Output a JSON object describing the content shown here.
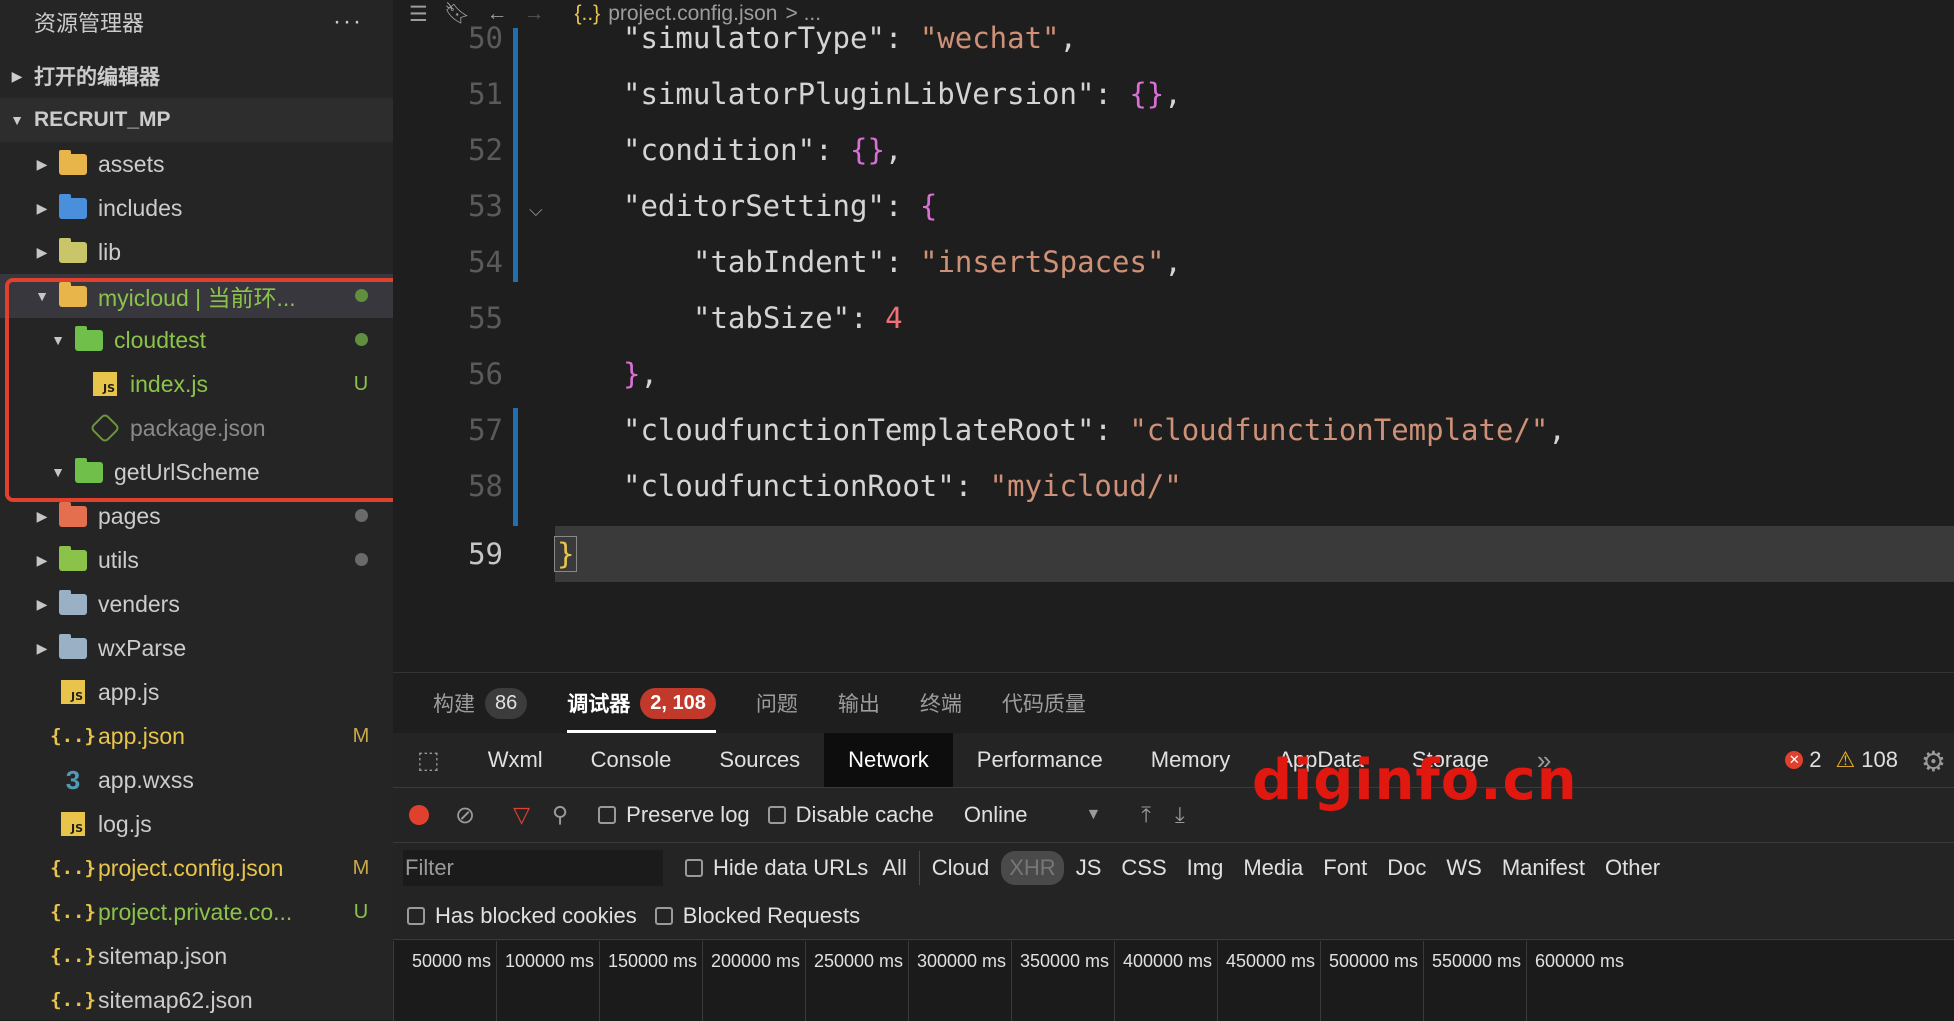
{
  "sidebar": {
    "title": "资源管理器",
    "more": "···",
    "open_editors": "打开的编辑器",
    "project": "RECRUIT_MP",
    "items": [
      {
        "label": "assets",
        "status": "",
        "icon": "folder-assets-icon"
      },
      {
        "label": "includes",
        "status": "",
        "icon": "folder-includes-icon"
      },
      {
        "label": "lib",
        "status": "",
        "icon": "folder-lib-icon"
      },
      {
        "label": "myicloud | 当前环...",
        "status": "",
        "icon": "folder-cloud-icon"
      },
      {
        "label": "cloudtest",
        "status": "",
        "icon": "folder-cloud-icon"
      },
      {
        "label": "index.js",
        "status": "U",
        "icon": "js-file-icon"
      },
      {
        "label": "package.json",
        "status": "",
        "icon": "package-json-icon"
      },
      {
        "label": "getUrlScheme",
        "status": "",
        "icon": "folder-cloud-icon"
      },
      {
        "label": "pages",
        "status": "",
        "icon": "folder-pages-icon"
      },
      {
        "label": "utils",
        "status": "",
        "icon": "folder-utils-icon"
      },
      {
        "label": "venders",
        "status": "",
        "icon": "folder-icon"
      },
      {
        "label": "wxParse",
        "status": "",
        "icon": "folder-icon"
      },
      {
        "label": "app.js",
        "status": "",
        "icon": "js-file-icon"
      },
      {
        "label": "app.json",
        "status": "M",
        "icon": "json-file-icon"
      },
      {
        "label": "app.wxss",
        "status": "",
        "icon": "wxss-file-icon"
      },
      {
        "label": "log.js",
        "status": "",
        "icon": "js-file-icon"
      },
      {
        "label": "project.config.json",
        "status": "M",
        "icon": "json-file-icon"
      },
      {
        "label": "project.private.co...",
        "status": "U",
        "icon": "json-file-icon"
      },
      {
        "label": "sitemap.json",
        "status": "",
        "icon": "json-file-icon"
      },
      {
        "label": "sitemap62.json",
        "status": "",
        "icon": "json-file-icon"
      }
    ]
  },
  "editor": {
    "breadcrumb": "project.config.json",
    "breadcrumb_icon": "{..}",
    "breadcrumb_more": "> ...",
    "lines": [
      {
        "num": "50",
        "key": "\"simulatorType\"",
        "val": "\"wechat\"",
        "tail": ","
      },
      {
        "num": "51",
        "key": "\"simulatorPluginLibVersion\"",
        "val": "{}",
        "tail": ","
      },
      {
        "num": "52",
        "key": "\"condition\"",
        "val": "{}",
        "tail": ","
      },
      {
        "num": "53",
        "key": "\"editorSetting\"",
        "val": "{",
        "tail": ""
      },
      {
        "num": "54",
        "key": "\"tabIndent\"",
        "val": "\"insertSpaces\"",
        "tail": ","
      },
      {
        "num": "55",
        "key": "\"tabSize\"",
        "val": "4",
        "tail": ""
      },
      {
        "num": "56",
        "key": "}",
        "val": "",
        "tail": ","
      },
      {
        "num": "57",
        "key": "\"cloudfunctionTemplateRoot\"",
        "val": "\"cloudfunctionTemplate/\"",
        "tail": ","
      },
      {
        "num": "58",
        "key": "\"cloudfunctionRoot\"",
        "val": "\"myicloud/\"",
        "tail": ""
      },
      {
        "num": "59",
        "key": "}",
        "val": "",
        "tail": ""
      }
    ]
  },
  "panel": {
    "tabs": [
      {
        "label": "构建",
        "badge": "86"
      },
      {
        "label": "调试器",
        "badge": "2, 108"
      },
      {
        "label": "问题",
        "badge": ""
      },
      {
        "label": "输出",
        "badge": ""
      },
      {
        "label": "终端",
        "badge": ""
      },
      {
        "label": "代码质量",
        "badge": ""
      }
    ],
    "devtools_tabs": [
      "Wxml",
      "Console",
      "Sources",
      "Network",
      "Performance",
      "Memory",
      "AppData",
      "Storage"
    ],
    "more": "»",
    "errors": "2",
    "warnings": "108",
    "preserve_log": "Preserve log",
    "disable_cache": "Disable cache",
    "throttle": "Online",
    "filter_placeholder": "Filter",
    "hide_data_urls": "Hide data URLs",
    "types": [
      "All",
      "Cloud",
      "XHR",
      "JS",
      "CSS",
      "Img",
      "Media",
      "Font",
      "Doc",
      "WS",
      "Manifest",
      "Other"
    ],
    "has_blocked_cookies": "Has blocked cookies",
    "blocked_requests": "Blocked Requests",
    "timeline": [
      "50000 ms",
      "100000 ms",
      "150000 ms",
      "200000 ms",
      "250000 ms",
      "300000 ms",
      "350000 ms",
      "400000 ms",
      "450000 ms",
      "500000 ms",
      "550000 ms",
      "600000 ms"
    ]
  },
  "watermark": "diginfo.cn",
  "colors": {
    "accent": "#1f6fb2",
    "error": "#e0412f",
    "green": "#8bc34a",
    "yellow": "#e8c54a"
  }
}
